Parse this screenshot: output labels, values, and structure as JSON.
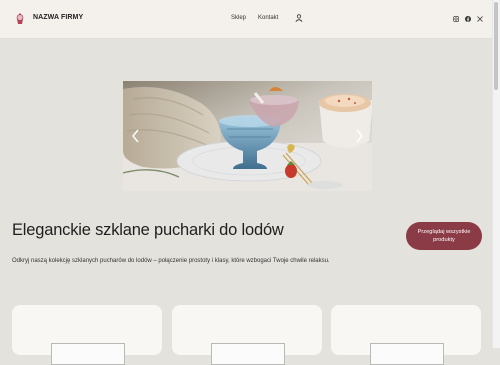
{
  "header": {
    "brand": "NAZWA FIRMY",
    "nav": [
      {
        "label": "Sklep"
      },
      {
        "label": "Kontakt"
      }
    ],
    "logo_icon": "cupcake-icon",
    "user_icon": "user-icon",
    "social_icons": [
      "instagram-icon",
      "facebook-icon",
      "x-icon"
    ]
  },
  "carousel": {
    "prev_icon": "chevron-left-icon",
    "next_icon": "chevron-right-icon"
  },
  "hero": {
    "title": "Eleganckie szklane pucharki do lodów",
    "description": "Odkryj naszą kolekcję szklanych pucharów do lodów – połączenie prostoty i klasy, które wzbogaci Twoje chwile relaksu.",
    "cta_label": "Przeglądaj wszystkie produkty"
  },
  "colors": {
    "header_bg": "#f4f1ec",
    "page_bg": "#e4e2dc",
    "accent": "#8a3b46"
  }
}
